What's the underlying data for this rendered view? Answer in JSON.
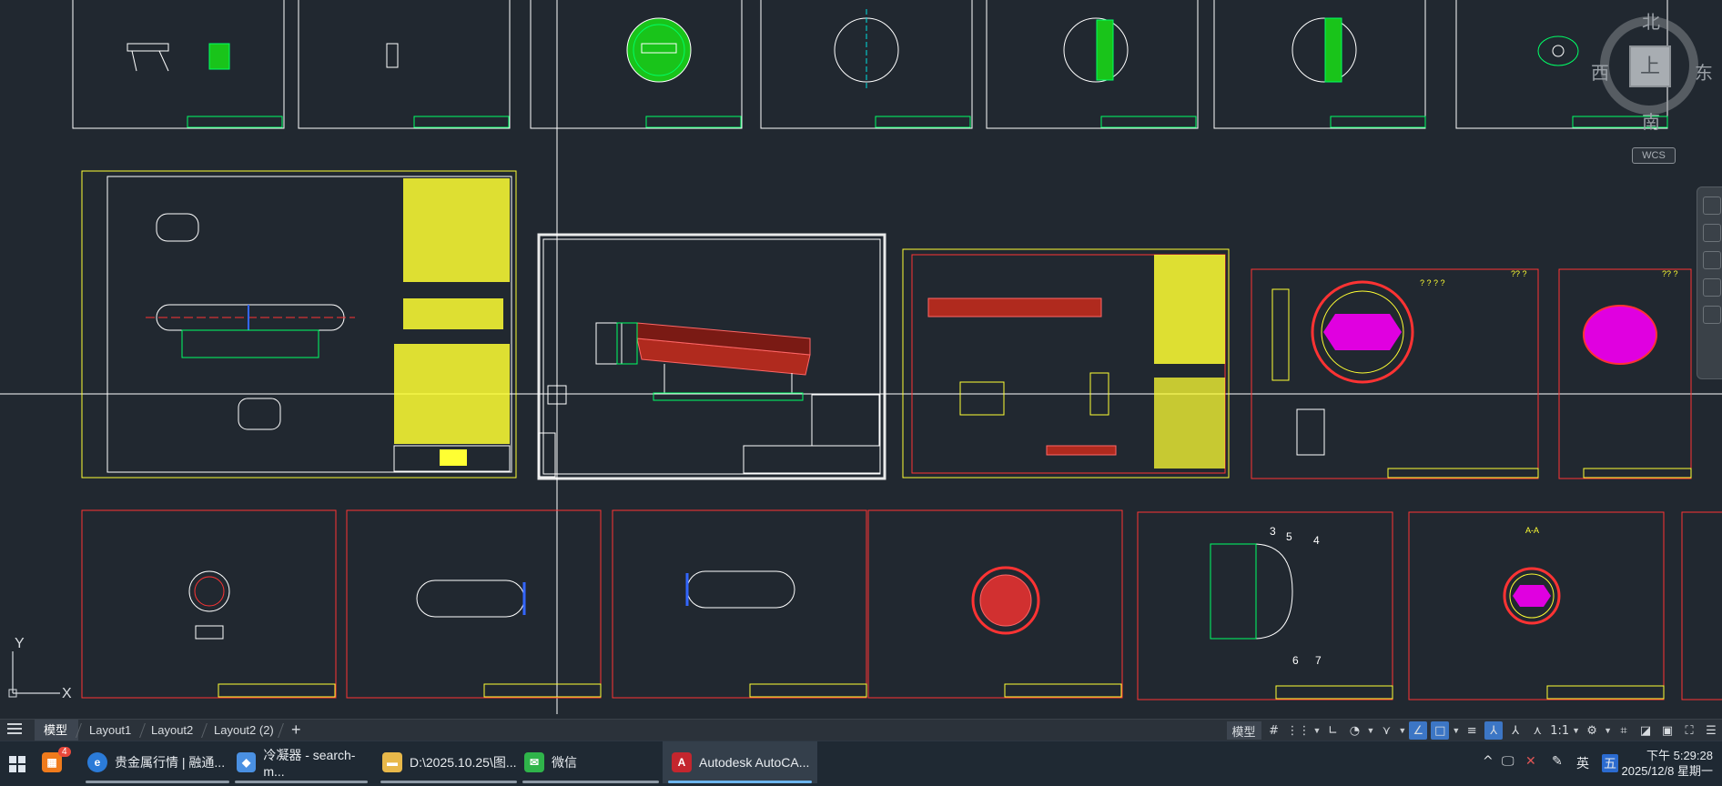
{
  "app": {
    "title": "Autodesk AutoCAD",
    "background": "#212830"
  },
  "viewcube": {
    "top": "北",
    "left": "西",
    "right": "东",
    "bottom": "南",
    "face": "上",
    "wcs_label": "WCS"
  },
  "ucs": {
    "x_label": "X",
    "y_label": "Y"
  },
  "layout_tabs": [
    {
      "label": "模型",
      "active": true
    },
    {
      "label": "Layout1",
      "active": false
    },
    {
      "label": "Layout2",
      "active": false
    },
    {
      "label": "Layout2 (2)",
      "active": false
    }
  ],
  "add_tab_symbol": "+",
  "statusbar": {
    "model_label": "模型",
    "scale": "1:1",
    "items": [
      "grid",
      "snap",
      "ortho",
      "polar",
      "isosnap",
      "osnap",
      "otrack",
      "lineweight",
      "annotation",
      "autoscale",
      "workspace",
      "customize"
    ]
  },
  "drawing_labels": {
    "balloon_3": "3",
    "balloon_4": "4",
    "balloon_5": "5",
    "balloon_6": "6",
    "balloon_7": "7",
    "section_aa": "A-A",
    "qmarks_1": "? ? ? ?",
    "qmarks_2": "?? ?",
    "qmarks_3": "?? ?"
  },
  "taskbar": {
    "items": [
      {
        "label": "贵金属行情 | 融通...",
        "icon": "edge-icon",
        "color": "#2b7bd8"
      },
      {
        "label": "冷凝器 - search-m...",
        "icon": "document-icon",
        "color": "#4a90e2"
      },
      {
        "label": "D:\\2025.10.25\\图...",
        "icon": "folder-icon",
        "color": "#e8b84a"
      },
      {
        "label": "微信",
        "icon": "wechat-icon",
        "color": "#2fb44a"
      },
      {
        "label": "Autodesk AutoCA...",
        "icon": "autocad-icon",
        "color": "#c4262e",
        "active": true
      }
    ],
    "badge_count": "4",
    "tray": {
      "ime": "英",
      "ime2": "五"
    },
    "clock": {
      "time": "下午 5:29:28",
      "date": "2025/12/8 星期一"
    }
  }
}
